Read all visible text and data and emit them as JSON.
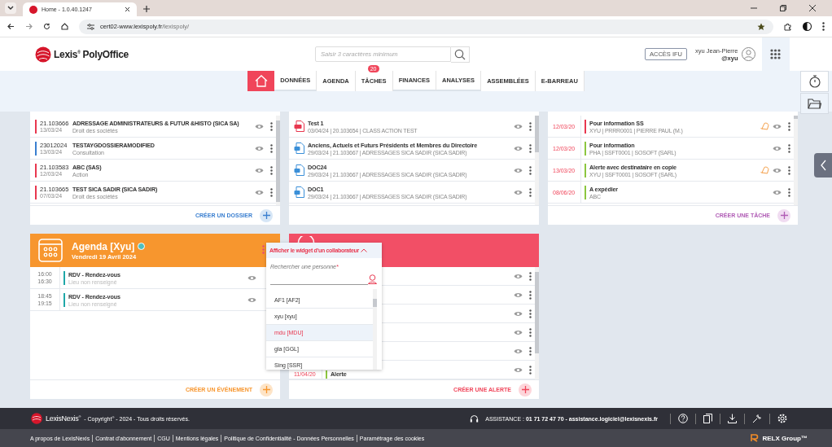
{
  "browser": {
    "tab_title": "Home - 1.0.40.1247",
    "url_host": "cert02-www.lexispoly.fr",
    "url_path": "/lexispoly/"
  },
  "header": {
    "logo": "Lexis$^{®}$ PolyOffice",
    "search": {
      "placeholder": "Saisir 3 caractères minimum"
    },
    "ifu_button": "ACCÈS IFU",
    "user": {
      "name": "xyu Jean-Pierre",
      "handle": "@xyu"
    }
  },
  "nav": [
    {
      "kind": "home",
      "selected": true
    },
    {
      "kind": "item",
      "label": "DONNÉES",
      "selected": false,
      "has_menu": true
    },
    {
      "kind": "item",
      "label": "AGENDA",
      "selected": false,
      "has_menu": false
    },
    {
      "kind": "item",
      "label": "TÂCHES",
      "selected": false,
      "has_menu": false,
      "badge": "20"
    },
    {
      "kind": "item",
      "label": "FINANCES",
      "selected": false,
      "has_menu": true
    },
    {
      "kind": "item",
      "label": "ANALYSES",
      "selected": false,
      "has_menu": true
    },
    {
      "kind": "item",
      "label": "ASSEMBLÉES",
      "selected": false,
      "has_menu": false
    },
    {
      "kind": "item",
      "label": "E-BARREAU",
      "selected": false,
      "has_menu": false
    }
  ],
  "dossiers": {
    "rows": [
      {
        "number": "21.103666",
        "date": "13/03/24",
        "title": "ADRESSAGE ADMINISTRATEURS & FUTUR &HISTO (SICA SA)",
        "category": "Droit des sociétés",
        "color": "#e8374f"
      },
      {
        "number": "23012024",
        "date": "13/03/24",
        "title": "TESTAYGDOSSIERAMODIFIED",
        "category": "Consultation",
        "color": "#3a7fd0"
      },
      {
        "number": "21.103583",
        "date": "12/03/24",
        "title": "ABC (SAS)",
        "category": "Action",
        "color": "#e8374f"
      },
      {
        "number": "21.103665",
        "date": "07/03/24",
        "title": "TEST SICA SADIR (SICA SADIR)",
        "category": "Droit des sociétés",
        "color": "#e8374f"
      }
    ],
    "create": "CRÉER UN DOSSIER"
  },
  "documents": {
    "rows": [
      {
        "kind": "pdf",
        "title": "Test 1",
        "meta": "03/04/24 | 20.103654 | CLASS ACTION TEST"
      },
      {
        "kind": "doc",
        "title": "Anciens, Actuels et Futurs Présidents et Membres du Directoire",
        "meta": "29/03/24 | 21.103667 | ADRESSAGES SICA SADIR (SICA SADIR)"
      },
      {
        "kind": "doc",
        "title": "DOC24",
        "meta": "29/03/24 | 21.103667 | ADRESSAGES SICA SADIR (SICA SADIR)"
      },
      {
        "kind": "doc",
        "title": "DOC1",
        "meta": "29/03/24 | 21.103667 | ADRESSAGES SICA SADIR (SICA SADIR)"
      }
    ]
  },
  "tasks": {
    "rows": [
      {
        "date": "12/03/20",
        "title": "Pour information SS",
        "meta": "XYU | PRRR0001 | PIERRE PAUL (M.)",
        "color": "#e8374f",
        "bell": true
      },
      {
        "date": "12/03/20",
        "title": "Pour information",
        "meta": "PHA | SSFT0001 | SOSOFT (SARL)",
        "color": "#8cc63f",
        "bell": false
      },
      {
        "date": "13/03/20",
        "title": "Alerte avec destinataire en copie",
        "meta": "XYU | SSFT0001 | SOSOFT (SARL)",
        "color": "#8cc63f",
        "bell": true
      },
      {
        "date": "08/06/20",
        "title": "A expédier",
        "meta": "ABC",
        "color": "#8cc63f",
        "bell": false
      }
    ],
    "create": "CRÉER UNE TÂCHE"
  },
  "agenda": {
    "title": "Agenda [Xyu]",
    "online": true,
    "subtitle": "Vendredi 19 Avril 2024",
    "events": [
      {
        "start": "16:00",
        "end": "16:30",
        "title": "RDV - Rendez-vous",
        "place": "Lieu non renseigné"
      },
      {
        "start": "18:45",
        "end": "19:15",
        "title": "RDV - Rendez-vous",
        "place": "Lieu non renseigné"
      }
    ],
    "create": "CRÉER UN ÉVÉNEMENT"
  },
  "alerts": {
    "rows": [
      {
        "date": "11/04/20",
        "title": "Alerte",
        "color": "#8cc63f"
      }
    ],
    "create": "CRÉER UNE ALERTE"
  },
  "collaborator_menu": {
    "title": "Afficher le widget d'un collaborateur",
    "expanded": true,
    "label": "Rechercher une personne",
    "required_mark": "*",
    "options": [
      {
        "label": "AF1 [AF2]",
        "selected": false
      },
      {
        "label": "xyu [xyu]",
        "selected": false
      },
      {
        "label": "mdu [MDU]",
        "selected": true
      },
      {
        "label": "gla [GGL]",
        "selected": false
      },
      {
        "label": "Sing [SSR]",
        "selected": false
      }
    ]
  },
  "footer": {
    "brand": "LexisNexis$^{®}$",
    "copyright": "- Copyright$^{®}$ - 2024 - Tous droits réservés.",
    "assistance": "ASSISTANCE : **01 71 72 47 70 - assistance.logiciel@lexisnexis.fr**",
    "links": [
      "A propos de LexisNexis",
      "Contrat d'abonnement",
      "CGU",
      "Mentions légales",
      "Politique de Confidentialité - Données Personnelles",
      "Paramétrage des cookies"
    ],
    "relx": "RELX Group™"
  }
}
